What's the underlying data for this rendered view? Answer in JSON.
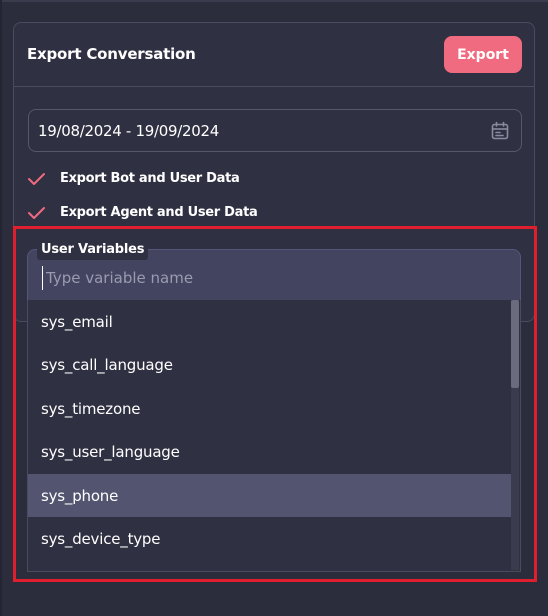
{
  "panel": {
    "title": "Export Conversation",
    "export_label": "Export",
    "accent_color": "#f16b80"
  },
  "date_range": {
    "value": "19/08/2024 - 19/09/2024",
    "icon": "calendar-icon"
  },
  "options": [
    {
      "label": "Export Bot and User Data",
      "checked": true,
      "icon": "check-icon"
    },
    {
      "label": "Export Agent and User Data",
      "checked": true,
      "icon": "check-icon"
    }
  ],
  "variables": {
    "label": "User Variables",
    "placeholder": "Type variable name",
    "items": [
      "sys_email",
      "sys_call_language",
      "sys_timezone",
      "sys_user_language",
      "sys_phone",
      "sys_device_type"
    ],
    "highlighted": "sys_phone",
    "highlight_color": "#e01f2e"
  }
}
